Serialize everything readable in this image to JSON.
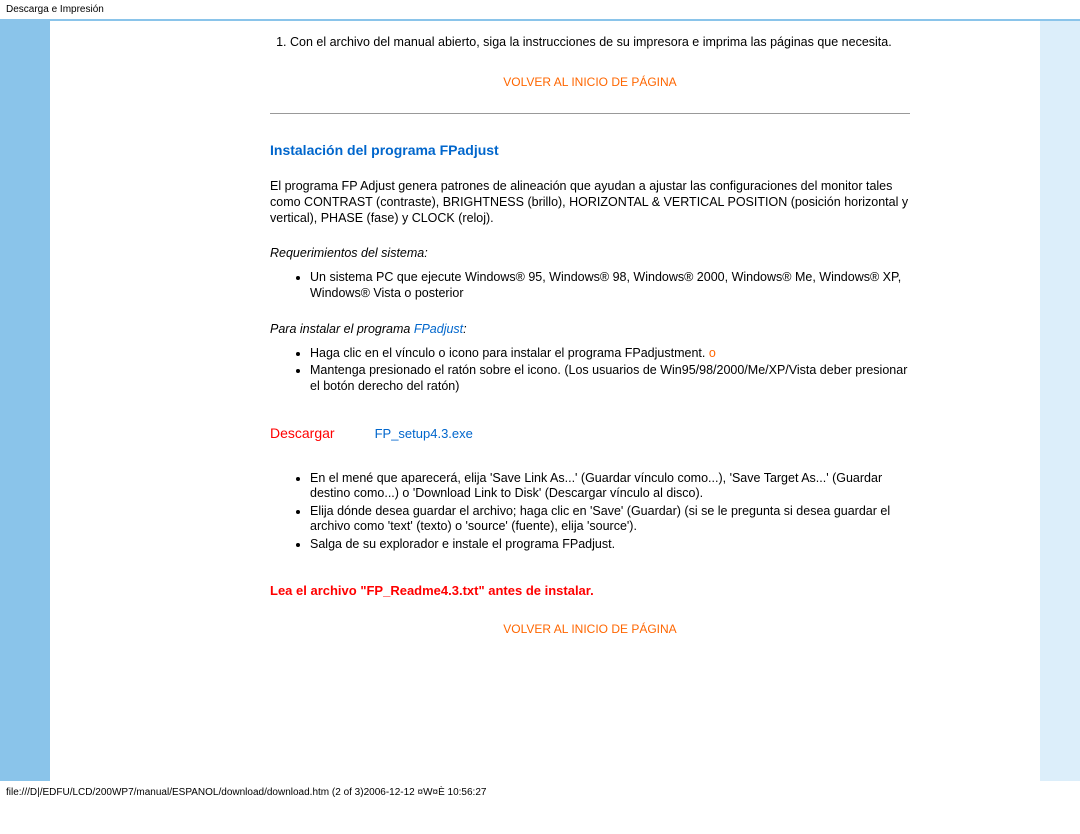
{
  "header": "Descarga e Impresión",
  "content": {
    "instruction_1": "Con el archivo del manual abierto, siga la instrucciones de su impresora e imprima las páginas que necesita.",
    "top_link_1": "VOLVER AL INICIO DE PÁGINA",
    "section_title": "Instalación del programa FPadjust",
    "intro_para": "El programa FP Adjust genera patrones de alineación que ayudan a ajustar las configuraciones del monitor tales como CONTRAST (contraste), BRIGHTNESS (brillo), HORIZONTAL & VERTICAL POSITION (posición horizontal y vertical), PHASE (fase) y CLOCK (reloj).",
    "req_label": "Requerimientos del sistema:",
    "req_item": "Un sistema PC que ejecute Windows® 95, Windows® 98, Windows® 2000, Windows® Me, Windows® XP, Windows® Vista o posterior",
    "install_prefix": "Para instalar el programa ",
    "install_linkword": "FPadjust",
    "install_suffix": ":",
    "install_item_1a": "Haga clic en el vínculo o icono para instalar el programa FPadjustment. ",
    "install_item_1b": "o",
    "install_item_2": "Mantenga presionado el ratón sobre el icono. (Los usuarios de Win95/98/2000/Me/XP/Vista deber presionar el botón derecho del ratón)",
    "download_label": "Descargar",
    "download_file": "FP_setup4.3.exe",
    "post_item_1": "En el mené que aparecerá, elija 'Save Link As...' (Guardar vínculo como...), 'Save Target As...' (Guardar destino como...) o 'Download Link to Disk' (Descargar vínculo al disco).",
    "post_item_2": "Elija dónde desea guardar el archivo; haga clic en 'Save' (Guardar) (si se le pregunta si desea guardar el archivo como 'text' (texto) o 'source' (fuente), elija 'source').",
    "post_item_3": "Salga de su explorador e instale el programa FPadjust.",
    "red_note": "Lea el archivo \"FP_Readme4.3.txt\" antes de instalar.",
    "top_link_2": "VOLVER AL INICIO DE PÁGINA"
  },
  "footer": "file:///D|/EDFU/LCD/200WP7/manual/ESPANOL/download/download.htm (2 of 3)2006-12-12 ¤W¤È 10:56:27"
}
